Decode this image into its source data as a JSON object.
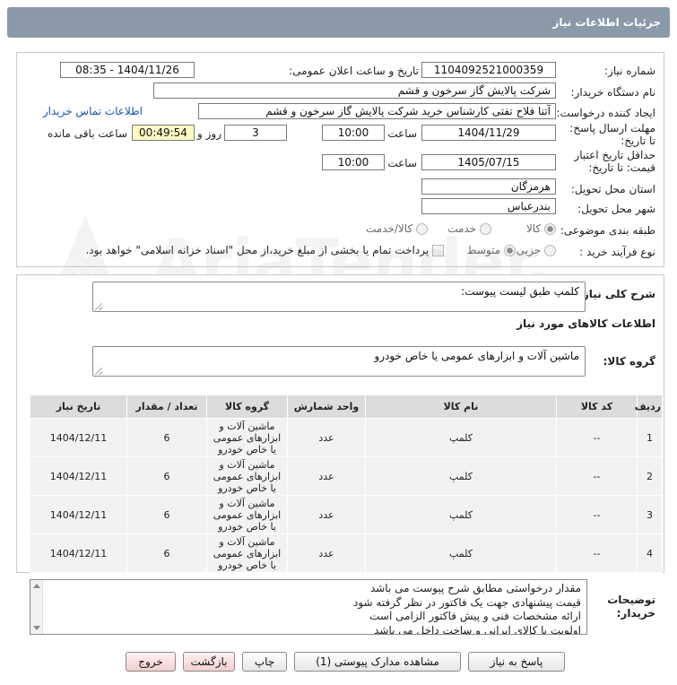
{
  "header": {
    "title": "جزئیات اطلاعات نیاز"
  },
  "labels": {
    "need_number": "شماره نیاز:",
    "announce_datetime": "تاریخ و ساعت اعلان عمومی:",
    "buyer_org": "نام دستگاه خریدار:",
    "requester": "ایجاد کننده درخواست:",
    "buyer_contact": "اطلاعات تماس خریدار",
    "reply_deadline": "مهلت ارسال پاسخ: تا تاریخ:",
    "time": "ساعت",
    "days_and": "روز و",
    "remaining": "ساعت باقی مانده",
    "price_validity": "حداقل تاریخ اعتبار قیمت: تا تاریخ:",
    "province": "استان محل تحویل:",
    "city": "شهر محل تحویل:",
    "category": "طبقه بندی موضوعی:",
    "process_type": "نوع فرآیند خرید :",
    "general_desc": "شرح کلی نیاز:",
    "goods_info": "اطلاعات کالاهای مورد نیاز",
    "goods_group": "گروه کالا:",
    "buyer_notes": "توضیحات خریدار:"
  },
  "fields": {
    "need_number": "1104092521000359",
    "announce_datetime": "1404/11/26 - 08:35",
    "buyer_org": "شرکت پالایش گاز سرخون و قشم",
    "requester": "آتنا فلاح تفتی کارشناس خرید شرکت پالایش گاز سرخون و قشم",
    "reply_date": "1404/11/29",
    "reply_time": "10:00",
    "days": "3",
    "remaining_time": "00:49:54",
    "validity_date": "1405/07/15",
    "validity_time": "10:00",
    "province": "هرمزگان",
    "city": "بندرعباس",
    "general_desc": "کلمپ طبق لیست پیوست:",
    "goods_group": "ماشین آلات و ابزارهای عمومی یا خاص خودرو"
  },
  "category_options": [
    {
      "label": "کالا",
      "selected": true
    },
    {
      "label": "خدمت",
      "selected": false
    },
    {
      "label": "کالا/خدمت",
      "selected": false
    }
  ],
  "process_options": [
    {
      "label": "جزیی",
      "selected": false
    },
    {
      "label": "متوسط",
      "selected": true
    }
  ],
  "payment_note": "پرداخت تمام یا بخشی از مبلغ خرید،از محل \"اسناد خزانه اسلامی\" خواهد بود.",
  "table": {
    "headers": [
      "ردیف",
      "کد کالا",
      "نام کالا",
      "واحد شمارش",
      "گروه کالا",
      "تعداد / مقدار",
      "تاریخ نیاز"
    ],
    "rows": [
      [
        "1",
        "--",
        "کلمپ",
        "عدد",
        "ماشین آلات و ابزارهای عمومی یا خاص خودرو",
        "6",
        "1404/12/11"
      ],
      [
        "2",
        "--",
        "کلمپ",
        "عدد",
        "ماشین آلات و ابزارهای عمومی یا خاص خودرو",
        "6",
        "1404/12/11"
      ],
      [
        "3",
        "--",
        "کلمپ",
        "عدد",
        "ماشین آلات و ابزارهای عمومی یا خاص خودرو",
        "6",
        "1404/12/11"
      ],
      [
        "4",
        "--",
        "کلمپ",
        "عدد",
        "ماشین آلات و ابزارهای عمومی یا خاص خودرو",
        "6",
        "1404/12/11"
      ]
    ]
  },
  "notes": [
    "مقدار درخواستی مطابق شرح پیوست می باشد",
    "قیمت پیشنهادی جهت یک فاکتور در نظر گرفته شود",
    "ارائه مشخصات فنی و پیش فاکتور الزامی است",
    "اولویت با کالای ایرانی و ساخت داخل می باشد"
  ],
  "buttons": {
    "reply": "پاسخ به نیاز",
    "attachments": "مشاهده مدارک پیوستی (1)",
    "print": "چاپ",
    "back": "بازگشت",
    "exit": "خروج"
  },
  "watermark": {
    "text": "AriaTender.neT"
  },
  "colors": {
    "header_bg": "#8a9aa9",
    "link": "#1a55b8",
    "timer_bg": "#fff9c4"
  }
}
